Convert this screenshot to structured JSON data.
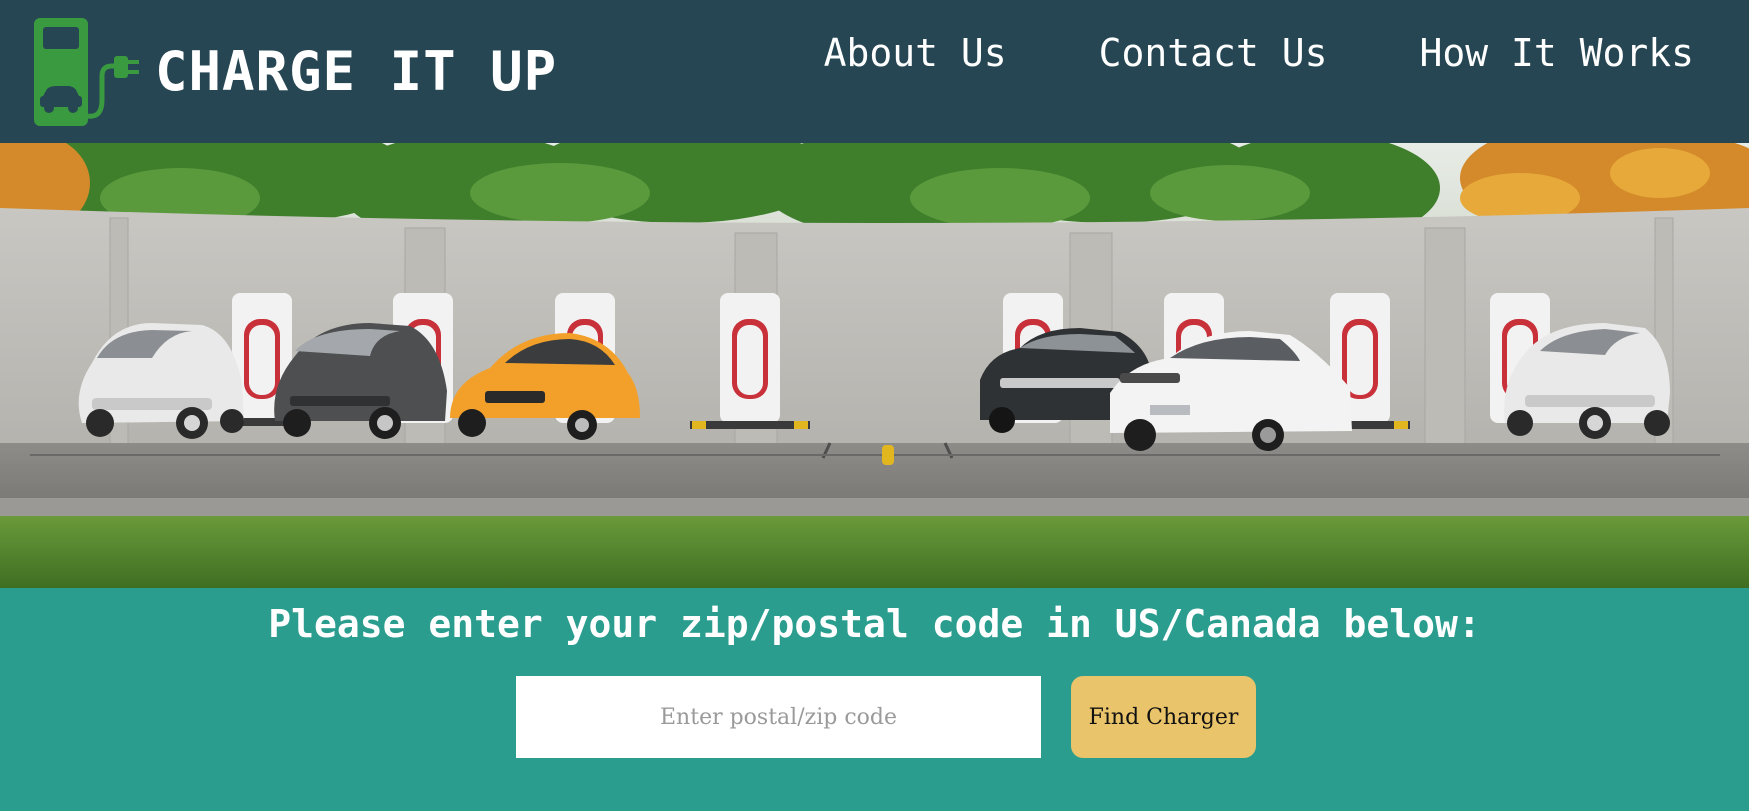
{
  "header": {
    "brand": "CHARGE IT UP",
    "logo_icon": "ev-charger-icon",
    "nav": [
      {
        "label": "About Us"
      },
      {
        "label": "Contact Us"
      },
      {
        "label": "How It Works"
      }
    ]
  },
  "hero": {
    "image": "ev-charging-station-photo"
  },
  "search": {
    "prompt": "Please enter your zip/postal code in US/Canada below:",
    "placeholder": "Enter postal/zip code",
    "value": "",
    "button_label": "Find Charger"
  },
  "colors": {
    "header_bg": "#264653",
    "section_bg": "#2a9d8e",
    "button_bg": "#e9c46a",
    "logo_green": "#3a9a3f"
  }
}
